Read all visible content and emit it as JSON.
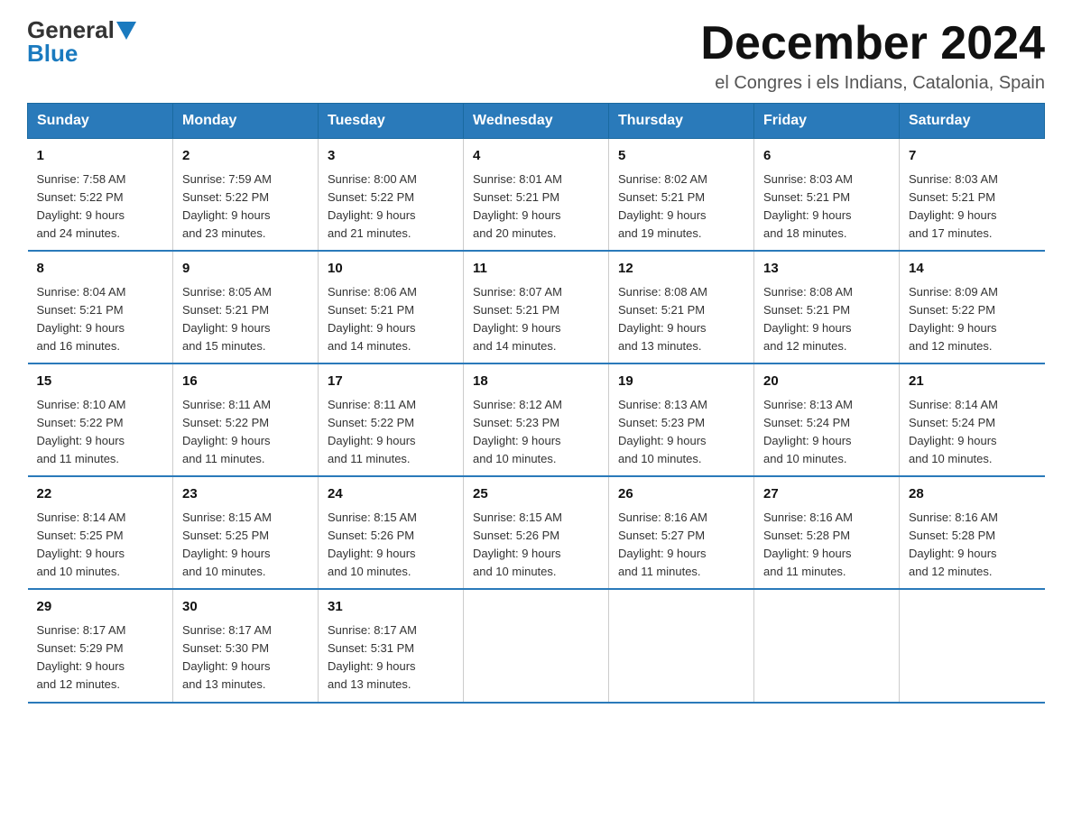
{
  "logo": {
    "general": "General",
    "blue": "Blue"
  },
  "title": "December 2024",
  "location": "el Congres i els Indians, Catalonia, Spain",
  "headers": [
    "Sunday",
    "Monday",
    "Tuesday",
    "Wednesday",
    "Thursday",
    "Friday",
    "Saturday"
  ],
  "weeks": [
    [
      {
        "day": "1",
        "sunrise": "7:58 AM",
        "sunset": "5:22 PM",
        "daylight": "9 hours and 24 minutes."
      },
      {
        "day": "2",
        "sunrise": "7:59 AM",
        "sunset": "5:22 PM",
        "daylight": "9 hours and 23 minutes."
      },
      {
        "day": "3",
        "sunrise": "8:00 AM",
        "sunset": "5:22 PM",
        "daylight": "9 hours and 21 minutes."
      },
      {
        "day": "4",
        "sunrise": "8:01 AM",
        "sunset": "5:21 PM",
        "daylight": "9 hours and 20 minutes."
      },
      {
        "day": "5",
        "sunrise": "8:02 AM",
        "sunset": "5:21 PM",
        "daylight": "9 hours and 19 minutes."
      },
      {
        "day": "6",
        "sunrise": "8:03 AM",
        "sunset": "5:21 PM",
        "daylight": "9 hours and 18 minutes."
      },
      {
        "day": "7",
        "sunrise": "8:03 AM",
        "sunset": "5:21 PM",
        "daylight": "9 hours and 17 minutes."
      }
    ],
    [
      {
        "day": "8",
        "sunrise": "8:04 AM",
        "sunset": "5:21 PM",
        "daylight": "9 hours and 16 minutes."
      },
      {
        "day": "9",
        "sunrise": "8:05 AM",
        "sunset": "5:21 PM",
        "daylight": "9 hours and 15 minutes."
      },
      {
        "day": "10",
        "sunrise": "8:06 AM",
        "sunset": "5:21 PM",
        "daylight": "9 hours and 14 minutes."
      },
      {
        "day": "11",
        "sunrise": "8:07 AM",
        "sunset": "5:21 PM",
        "daylight": "9 hours and 14 minutes."
      },
      {
        "day": "12",
        "sunrise": "8:08 AM",
        "sunset": "5:21 PM",
        "daylight": "9 hours and 13 minutes."
      },
      {
        "day": "13",
        "sunrise": "8:08 AM",
        "sunset": "5:21 PM",
        "daylight": "9 hours and 12 minutes."
      },
      {
        "day": "14",
        "sunrise": "8:09 AM",
        "sunset": "5:22 PM",
        "daylight": "9 hours and 12 minutes."
      }
    ],
    [
      {
        "day": "15",
        "sunrise": "8:10 AM",
        "sunset": "5:22 PM",
        "daylight": "9 hours and 11 minutes."
      },
      {
        "day": "16",
        "sunrise": "8:11 AM",
        "sunset": "5:22 PM",
        "daylight": "9 hours and 11 minutes."
      },
      {
        "day": "17",
        "sunrise": "8:11 AM",
        "sunset": "5:22 PM",
        "daylight": "9 hours and 11 minutes."
      },
      {
        "day": "18",
        "sunrise": "8:12 AM",
        "sunset": "5:23 PM",
        "daylight": "9 hours and 10 minutes."
      },
      {
        "day": "19",
        "sunrise": "8:13 AM",
        "sunset": "5:23 PM",
        "daylight": "9 hours and 10 minutes."
      },
      {
        "day": "20",
        "sunrise": "8:13 AM",
        "sunset": "5:24 PM",
        "daylight": "9 hours and 10 minutes."
      },
      {
        "day": "21",
        "sunrise": "8:14 AM",
        "sunset": "5:24 PM",
        "daylight": "9 hours and 10 minutes."
      }
    ],
    [
      {
        "day": "22",
        "sunrise": "8:14 AM",
        "sunset": "5:25 PM",
        "daylight": "9 hours and 10 minutes."
      },
      {
        "day": "23",
        "sunrise": "8:15 AM",
        "sunset": "5:25 PM",
        "daylight": "9 hours and 10 minutes."
      },
      {
        "day": "24",
        "sunrise": "8:15 AM",
        "sunset": "5:26 PM",
        "daylight": "9 hours and 10 minutes."
      },
      {
        "day": "25",
        "sunrise": "8:15 AM",
        "sunset": "5:26 PM",
        "daylight": "9 hours and 10 minutes."
      },
      {
        "day": "26",
        "sunrise": "8:16 AM",
        "sunset": "5:27 PM",
        "daylight": "9 hours and 11 minutes."
      },
      {
        "day": "27",
        "sunrise": "8:16 AM",
        "sunset": "5:28 PM",
        "daylight": "9 hours and 11 minutes."
      },
      {
        "day": "28",
        "sunrise": "8:16 AM",
        "sunset": "5:28 PM",
        "daylight": "9 hours and 12 minutes."
      }
    ],
    [
      {
        "day": "29",
        "sunrise": "8:17 AM",
        "sunset": "5:29 PM",
        "daylight": "9 hours and 12 minutes."
      },
      {
        "day": "30",
        "sunrise": "8:17 AM",
        "sunset": "5:30 PM",
        "daylight": "9 hours and 13 minutes."
      },
      {
        "day": "31",
        "sunrise": "8:17 AM",
        "sunset": "5:31 PM",
        "daylight": "9 hours and 13 minutes."
      },
      null,
      null,
      null,
      null
    ]
  ],
  "labels": {
    "sunrise": "Sunrise:",
    "sunset": "Sunset:",
    "daylight": "Daylight:"
  }
}
